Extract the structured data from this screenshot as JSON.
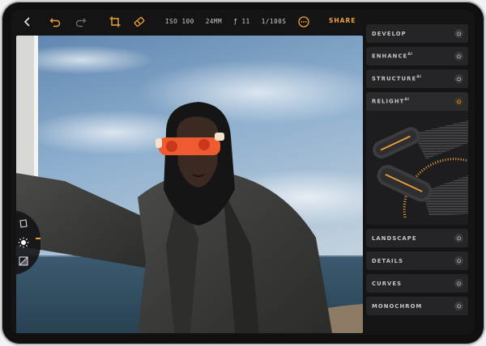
{
  "toolbar": {
    "icons": [
      "back-chevron-icon",
      "undo-icon",
      "redo-icon",
      "crop-icon",
      "eraser-icon",
      "more-icon"
    ],
    "meta": [
      "ISO 100",
      "24MM",
      "ƒ 11",
      "1/100S"
    ],
    "share_label": "SHARE",
    "accent": "#f0a23a"
  },
  "panel": {
    "items": [
      {
        "label": "DEVELOP",
        "sup": "",
        "active": false
      },
      {
        "label": "ENHANCE",
        "sup": "AI",
        "active": false
      },
      {
        "label": "STRUCTURE",
        "sup": "AI",
        "active": false
      },
      {
        "label": "RELIGHT",
        "sup": "AI",
        "active": true
      },
      {
        "label": "LANDSCAPE",
        "sup": "",
        "active": false
      },
      {
        "label": "DETAILS",
        "sup": "",
        "active": false
      },
      {
        "label": "CURVES",
        "sup": "",
        "active": false
      },
      {
        "label": "MONOCHROM",
        "sup": "",
        "active": false
      }
    ]
  },
  "dock": {
    "tools": [
      "layers-icon",
      "light-bulb-icon",
      "split-compare-icon"
    ],
    "active": "light-bulb-icon"
  }
}
